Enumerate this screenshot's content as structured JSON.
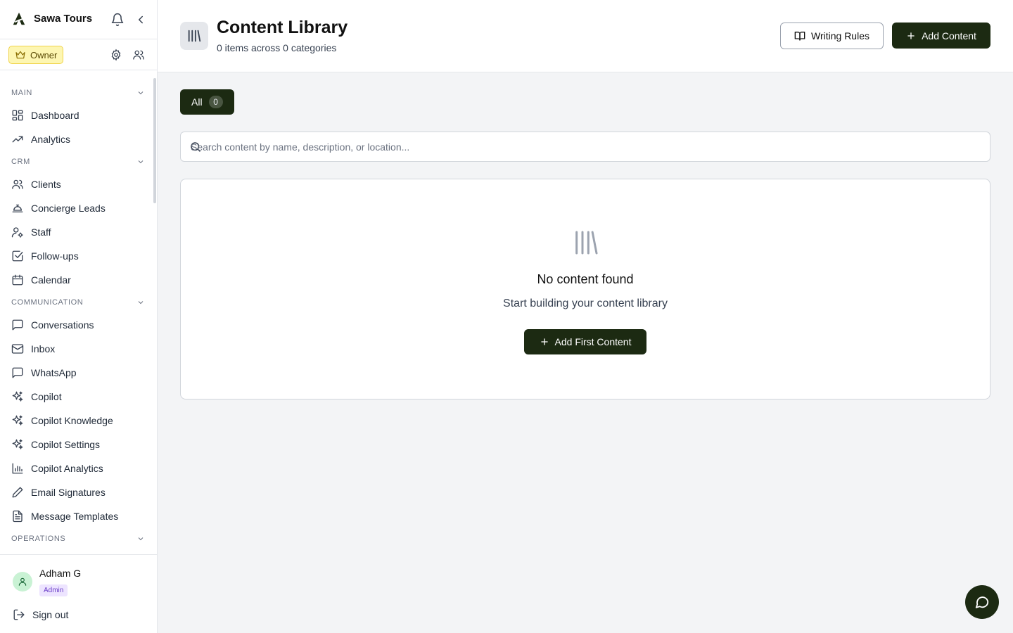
{
  "brand": {
    "name": "Sawa Tours"
  },
  "role": {
    "label": "Owner"
  },
  "nav": {
    "sections": {
      "main": "MAIN",
      "crm": "CRM",
      "communication": "COMMUNICATION",
      "operations": "OPERATIONS"
    },
    "items": {
      "dashboard": "Dashboard",
      "analytics": "Analytics",
      "clients": "Clients",
      "concierge_leads": "Concierge Leads",
      "staff": "Staff",
      "follow_ups": "Follow-ups",
      "calendar": "Calendar",
      "conversations": "Conversations",
      "inbox": "Inbox",
      "whatsapp": "WhatsApp",
      "copilot": "Copilot",
      "copilot_knowledge": "Copilot Knowledge",
      "copilot_settings": "Copilot Settings",
      "copilot_analytics": "Copilot Analytics",
      "email_signatures": "Email Signatures",
      "message_templates": "Message Templates"
    }
  },
  "user": {
    "name": "Adham G",
    "badge": "Admin",
    "sign_out": "Sign out"
  },
  "header": {
    "title": "Content Library",
    "subtitle": "0 items across 0 categories",
    "writing_rules": "Writing Rules",
    "add_content": "Add Content"
  },
  "filters": {
    "all_label": "All",
    "all_count": "0"
  },
  "search": {
    "placeholder": "Search content by name, description, or location..."
  },
  "empty": {
    "title": "No content found",
    "subtitle": "Start building your content library",
    "button": "Add First Content"
  },
  "colors": {
    "accent": "#1c2a12",
    "owner_badge": "#fdf6b2",
    "admin_badge": "#ede4ff"
  }
}
